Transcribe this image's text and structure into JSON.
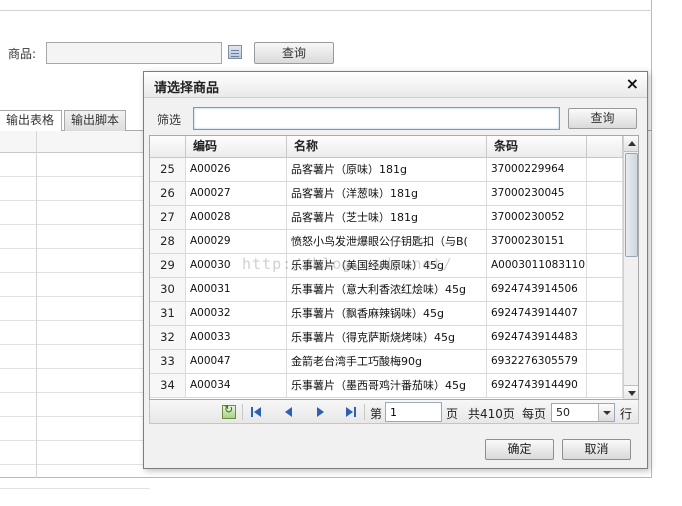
{
  "background": {
    "product_label": "商品:",
    "query_button": "查询",
    "tabs": [
      "输出表格",
      "输出脚本"
    ]
  },
  "dialog": {
    "title": "请选择商品",
    "close_glyph": "×",
    "filter_label": "筛选",
    "filter_value": "",
    "filter_query_button": "查询",
    "columns": [
      "编码",
      "名称",
      "条码"
    ],
    "rows": [
      {
        "idx": "25",
        "code": "A00026",
        "name": "品客薯片（原味）181g",
        "barcode": "37000229964"
      },
      {
        "idx": "26",
        "code": "A00027",
        "name": "品客薯片（洋葱味）181g",
        "barcode": "37000230045"
      },
      {
        "idx": "27",
        "code": "A00028",
        "name": "品客薯片（芝士味）181g",
        "barcode": "37000230052"
      },
      {
        "idx": "28",
        "code": "A00029",
        "name": "愤怒小鸟发泄爆眼公仔钥匙扣（与B(",
        "barcode": "37000230151"
      },
      {
        "idx": "29",
        "code": "A00030",
        "name": "乐事薯片（美国经典原味）45g",
        "barcode": "A0003011083110"
      },
      {
        "idx": "30",
        "code": "A00031",
        "name": "乐事薯片（意大利香浓红烩味）45g",
        "barcode": "6924743914506"
      },
      {
        "idx": "31",
        "code": "A00032",
        "name": "乐事薯片（飘香麻辣锅味）45g",
        "barcode": "6924743914407"
      },
      {
        "idx": "32",
        "code": "A00033",
        "name": "乐事薯片（得克萨斯烧烤味）45g",
        "barcode": "6924743914483"
      },
      {
        "idx": "33",
        "code": "A00047",
        "name": "金箭老台湾手工巧酸梅90g",
        "barcode": "6932276305579"
      },
      {
        "idx": "34",
        "code": "A00034",
        "name": "乐事薯片（墨西哥鸡汁番茄味）45g",
        "barcode": "6924743914490"
      }
    ],
    "pager": {
      "page_prefix": "第",
      "page_value": "1",
      "page_suffix": "页",
      "total_text": "共410页",
      "per_page_label": "每页",
      "page_size": "50",
      "rows_suffix": "行"
    },
    "ok_button": "确定",
    "cancel_button": "取消"
  },
  "watermark": "http://blog.csdn.net/"
}
